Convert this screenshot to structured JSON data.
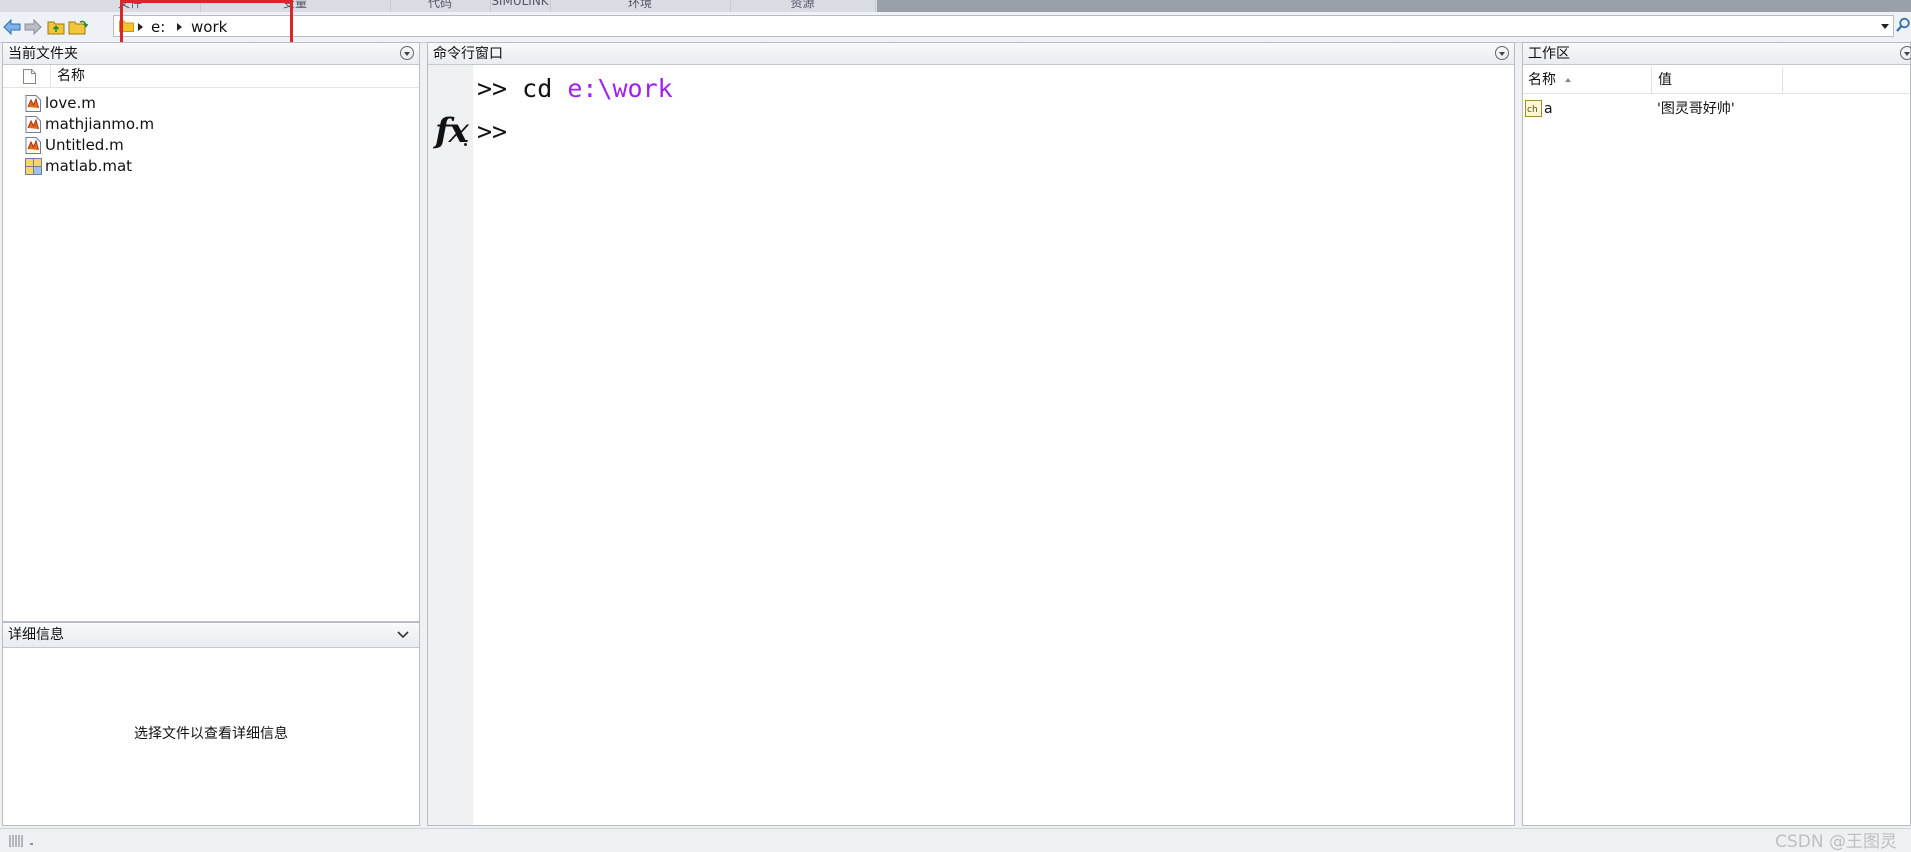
{
  "ribbon": {
    "tabs": [
      "文件",
      "变量",
      "代码",
      "SIMULINK",
      "环境",
      "资源"
    ]
  },
  "path": {
    "segments": [
      "e:",
      "work"
    ]
  },
  "current_folder": {
    "title": "当前文件夹",
    "column_name": "名称",
    "files": [
      {
        "name": "love.m",
        "icon": "m-file-icon"
      },
      {
        "name": "mathjianmo.m",
        "icon": "m-file-icon"
      },
      {
        "name": "Untitled.m",
        "icon": "m-file-icon"
      },
      {
        "name": "matlab.mat",
        "icon": "mat-file-icon"
      }
    ]
  },
  "details": {
    "title": "详细信息",
    "placeholder": "选择文件以查看详细信息"
  },
  "command_window": {
    "title": "命令行窗口",
    "prompt": ">>",
    "history": [
      {
        "command": "cd",
        "argument": "e:\\work"
      }
    ],
    "fx_label": "fx"
  },
  "workspace": {
    "title": "工作区",
    "col_name": "名称",
    "col_value": "值",
    "variables": [
      {
        "name": "a",
        "value": "'图灵哥好帅'"
      }
    ]
  },
  "watermark": "CSDN @王图灵",
  "colors": {
    "highlight_box": "#d9262b",
    "string_purple": "#a020f0"
  }
}
